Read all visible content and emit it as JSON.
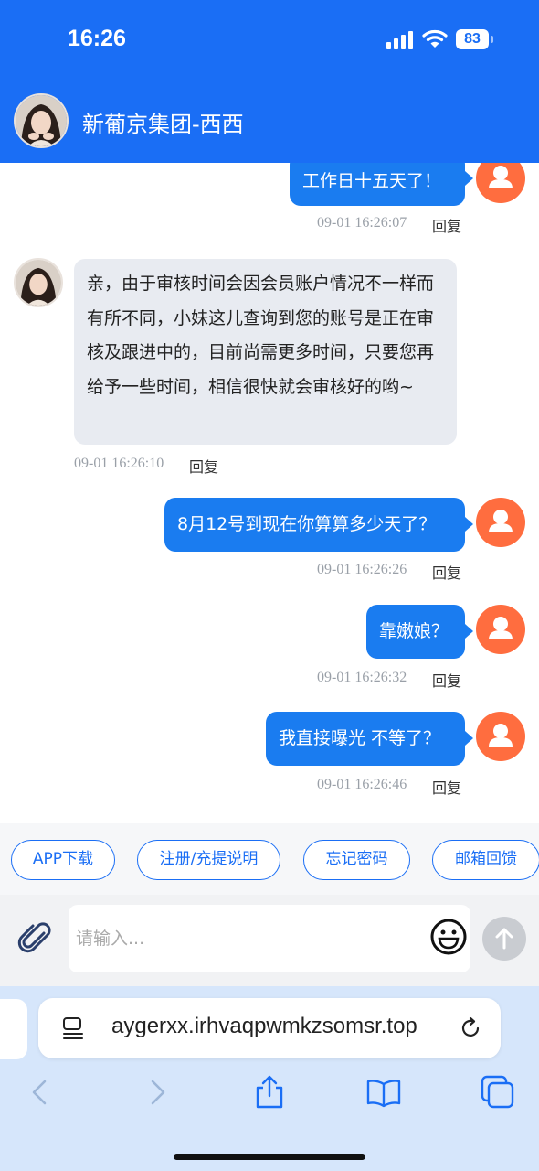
{
  "status_bar": {
    "time": "16:26",
    "battery": "83"
  },
  "header": {
    "contact_name": "新葡京集团-西西"
  },
  "messages": [
    {
      "side": "out",
      "text": "工作日十五天了！",
      "time": "09-01 16:26:07",
      "reply": "回复"
    },
    {
      "side": "in",
      "text": "亲，由于审核时间会因会员账户情况不一样而有所不同，小妹这儿查询到您的账号是正在审核及跟进中的，目前尚需更多时间，只要您再给予一些时间，相信很快就会审核好的哟~",
      "time": "09-01 16:26:10",
      "reply": "回复"
    },
    {
      "side": "out",
      "text": "8月12号到现在你算算多少天了？",
      "time": "09-01 16:26:26",
      "reply": "回复"
    },
    {
      "side": "out",
      "text": "靠嫩娘？",
      "time": "09-01 16:26:32",
      "reply": "回复"
    },
    {
      "side": "out",
      "text": "我直接曝光 不等了？",
      "time": "09-01 16:26:46",
      "reply": "回复"
    }
  ],
  "quick_replies": [
    "APP下载",
    "注册/充提说明",
    "忘记密码",
    "邮箱回馈"
  ],
  "input": {
    "placeholder": "请输入..."
  },
  "browser": {
    "url": "aygerxx.irhvaqpwmkzsomsr.top"
  },
  "colors": {
    "header_blue": "#1a6ef5",
    "bubble_blue": "#1a7cf0",
    "user_avatar_orange": "#ff6d3f",
    "incoming_bubble": "#e8ebf1"
  }
}
